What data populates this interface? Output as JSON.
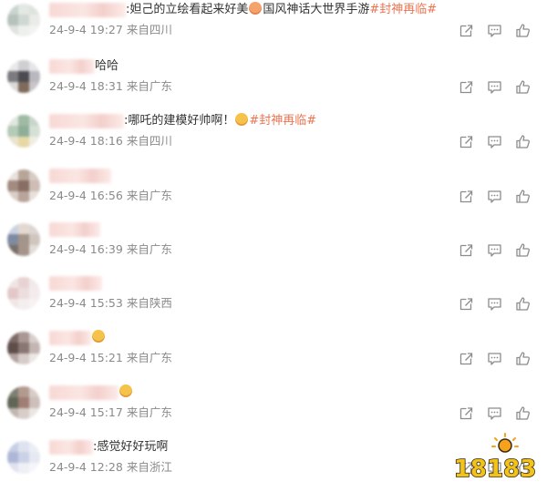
{
  "comments": [
    {
      "name_w": 84,
      "pre": ":妲己的立绘看起来好美",
      "post": "国风神话大世界手游",
      "topic": "#封神再临#",
      "time": "24-9-4 19:27",
      "location": "来自四川",
      "emoji": "face-emoji",
      "emoji_color": "#f3a36b",
      "avatar": [
        "#c9d4cf",
        "#e4e8e3",
        "#dfe3de",
        "#b7c2bb",
        "#d0d8d2",
        "#e9ece8",
        "#dfe3df",
        "#eef0ec",
        "#f3f3f1"
      ]
    },
    {
      "name_w": 50,
      "pre": "哈哈",
      "post": "",
      "topic": "",
      "time": "24-9-4 18:31",
      "location": "来自广东",
      "emoji": "",
      "emoji_color": "",
      "avatar": [
        "#e9e9ea",
        "#cfcfd2",
        "#e6e5e7",
        "#7b7b80",
        "#4c4b52",
        "#b9b8bf",
        "#dbdad9",
        "#7f6b5b",
        "#c8c6c8"
      ]
    },
    {
      "name_w": 82,
      "pre": ":哪吒的建模好帅啊！",
      "post": "",
      "topic": "#封神再临#",
      "time": "24-9-4 18:16",
      "location": "来自四川",
      "emoji": "surprised-emoji",
      "emoji_color": "#f5c24a",
      "avatar": [
        "#dfe7de",
        "#9fbaa5",
        "#c8d6c9",
        "#b4cbb8",
        "#8fae98",
        "#d6e0d6",
        "#eae4cf",
        "#e7d9a5",
        "#f0ede2"
      ]
    },
    {
      "name_w": 68,
      "pre": "",
      "post": "",
      "topic": "",
      "time": "24-9-4 16:56",
      "location": "来自广东",
      "emoji": "",
      "emoji_color": "",
      "avatar": [
        "#e8e1dc",
        "#b8a59a",
        "#d7cbc3",
        "#a38b80",
        "#876d63",
        "#cdbdb4",
        "#d9cfc8",
        "#b9a49a",
        "#e7e0db"
      ]
    },
    {
      "name_w": 56,
      "pre": "",
      "post": "",
      "topic": "",
      "time": "24-9-4 16:39",
      "location": "来自广东",
      "emoji": "",
      "emoji_color": "",
      "avatar": [
        "#c9d3e2",
        "#e4d9d2",
        "#dcd5d1",
        "#7f8ba1",
        "#a49489",
        "#cfc6c0",
        "#7a6f6a",
        "#a59489",
        "#e2ddd9"
      ]
    },
    {
      "name_w": 58,
      "pre": "",
      "post": "",
      "topic": "",
      "time": "24-9-4 15:53",
      "location": "来自陕西",
      "emoji": "",
      "emoji_color": "",
      "avatar": [
        "#f0e4e4",
        "#e8d3d3",
        "#f2eaea",
        "#e4c8c8",
        "#ecdede",
        "#f4ecec",
        "#f1e6e6",
        "#f4eeee",
        "#f7f3f3"
      ]
    },
    {
      "name_w": 46,
      "pre": "",
      "post": "",
      "topic": "",
      "time": "24-9-4 15:21",
      "location": "来自广东",
      "emoji": "grin-emoji",
      "emoji_color": "#f5c24a",
      "avatar": [
        "#7c6a66",
        "#a99894",
        "#d8cfcc",
        "#5e4e4b",
        "#8a7673",
        "#c3b6b2",
        "#b2a3a0",
        "#d6ccc9",
        "#ece7e5"
      ]
    },
    {
      "name_w": 76,
      "pre": "",
      "post": "",
      "topic": "",
      "time": "24-9-4 15:17",
      "location": "来自广东",
      "emoji": "grin-emoji",
      "emoji_color": "#f5c24a",
      "avatar": [
        "#7d7f72",
        "#b29a90",
        "#d7ccc6",
        "#5f6655",
        "#a07d75",
        "#cdbfb9",
        "#c1b7b1",
        "#d8cec9",
        "#ebe6e3"
      ]
    },
    {
      "name_w": 48,
      "pre": ":感觉好好玩啊",
      "post": "",
      "topic": "",
      "time": "24-9-4 12:28",
      "location": "来自浙江",
      "emoji": "",
      "emoji_color": "",
      "avatar": [
        "#c7cfe6",
        "#dfe3f0",
        "#eceef5",
        "#aeb8d6",
        "#cbd2e7",
        "#e6e9f2",
        "#dfe3ef",
        "#eef0f6",
        "#f5f6fa"
      ]
    }
  ],
  "icons": {
    "forward": "forward-icon",
    "comment": "comment-icon",
    "like": "like-icon"
  },
  "watermark": {
    "text": "18183",
    "color": "#f2c318",
    "outline": "#3a2a12"
  }
}
